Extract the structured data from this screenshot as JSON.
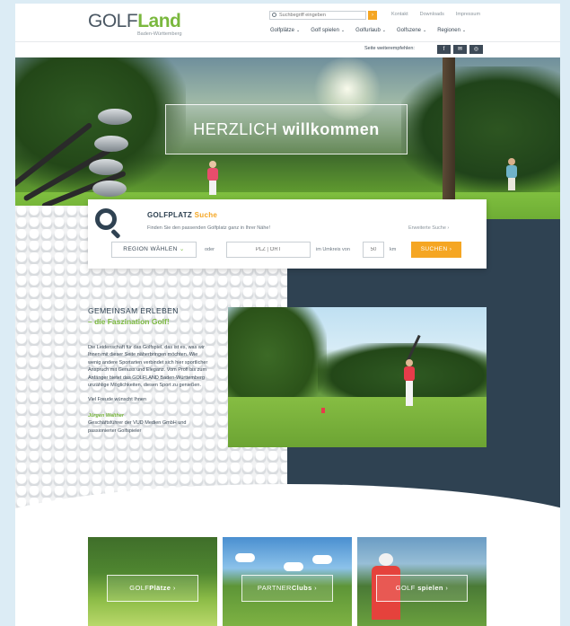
{
  "header": {
    "logo_golf": "GOLF",
    "logo_land": "Land",
    "logo_sub": "Baden-Württemberg",
    "search_placeholder": "Suchbegriff eingeben",
    "search_go": "›",
    "top_links": [
      "Kontakt",
      "Downloads",
      "Impressum"
    ],
    "nav": [
      "Golfplätze",
      "Golf spielen",
      "Golfurlaub",
      "Golfszene",
      "Regionen"
    ],
    "share_label": "Seite weiterempfehlen:",
    "share_buttons": [
      "f",
      "✉",
      "◎"
    ]
  },
  "hero": {
    "welcome_light": "HERZLICH ",
    "welcome_bold": "willkommen"
  },
  "search": {
    "title": "GOLFPLATZ ",
    "title_accent": "Suche",
    "subtitle": "Finden Sie den passenden Golfplatz ganz in Ihrer Nähe!",
    "extended": "Erweiterte Suche ›",
    "region_label": "REGION WÄHLEN",
    "region_chevron": "⌄",
    "or": "oder",
    "plz_placeholder": "PLZ | ORT",
    "radius_label": "im Umkreis von",
    "radius_placeholder": "50",
    "km": "km",
    "submit": "SUCHEN ›"
  },
  "intro": {
    "heading1": "GEMEINSAM ERLEBEN",
    "heading2": "– die Faszination Golf!",
    "paragraph": "Die Leidenschaft für das Golfspiel, das ist es, was wir Ihnen mit dieser Seite näherbringen möchten. Wie wenig andere Sportarten verbindet sich hier sportlicher Anspruch mit Genuss und Eleganz. Vom Profi bis zum Anfänger bietet das GOLFLAND Baden-Württemberg unzählige Möglichkeiten, diesen Sport zu genießen.",
    "wish": "Viel Freude wünscht Ihnen",
    "name": "Jürgen Walther",
    "role": "Geschäftsführer der VUD Medien GmbH und passionierter Golfspieler"
  },
  "cards": [
    {
      "light": "GOLF",
      "bold": "Plätze",
      "arrow": " ›"
    },
    {
      "light": "PARTNER",
      "bold": "Clubs",
      "arrow": " ›"
    },
    {
      "light": "GOLF ",
      "bold": "spielen",
      "arrow": " ›"
    }
  ],
  "colors": {
    "accent_orange": "#f5a623",
    "accent_green": "#7ab83e",
    "dark_navy": "#2f4252",
    "page_bg": "#dcecf5"
  }
}
